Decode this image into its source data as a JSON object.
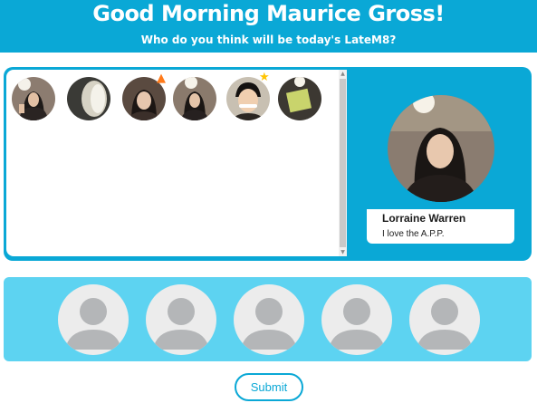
{
  "header": {
    "title": "Good Morning Maurice Gross!",
    "subtitle": "Who do you think will be today's LateM8?"
  },
  "candidates": [
    {
      "photo": "candidate-photo-1",
      "badge": null
    },
    {
      "photo": "candidate-photo-2",
      "badge": null
    },
    {
      "photo": "candidate-photo-3",
      "badge": "fire-icon"
    },
    {
      "photo": "candidate-photo-4",
      "badge": null
    },
    {
      "photo": "candidate-photo-5",
      "badge": "star-icon"
    },
    {
      "photo": "candidate-photo-6",
      "badge": null
    }
  ],
  "profile": {
    "name": "Lorraine Warren",
    "message": "I love the A.P.P."
  },
  "selection_slots": [
    {
      "state": "empty",
      "icon": "default-user-icon"
    },
    {
      "state": "empty",
      "icon": "default-user-icon"
    },
    {
      "state": "empty",
      "icon": "default-user-icon"
    },
    {
      "state": "empty",
      "icon": "default-user-icon"
    },
    {
      "state": "empty",
      "icon": "default-user-icon"
    }
  ],
  "actions": {
    "submit_label": "Submit"
  },
  "colors": {
    "primary": "#0aa8d6",
    "light": "#5dd3f1",
    "slot_bg": "#ececec",
    "placeholder": "#b4b6b8"
  }
}
